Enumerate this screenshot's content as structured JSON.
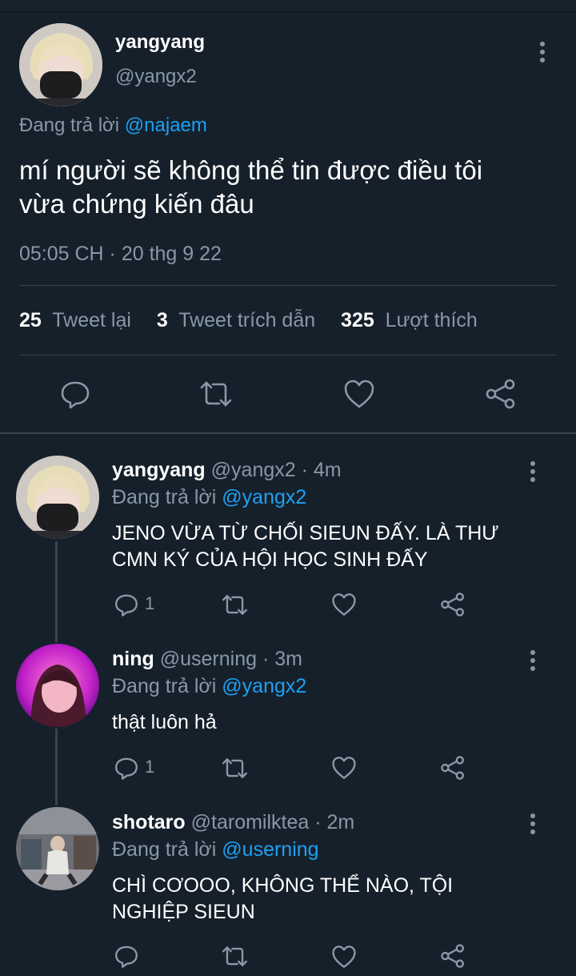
{
  "main_tweet": {
    "display_name": "yangyang",
    "handle": "@yangx2",
    "reply_prefix": "Đang trả lời",
    "reply_to": "@najaem",
    "text_line1": "mí người sẽ không thể tin được điều tôi",
    "text_line2": "vừa chứng kiến đâu",
    "timestamp": "05:05 CH · 20 thg 9 22",
    "retweets": "25",
    "retweets_label": "Tweet lại",
    "quotes": "3",
    "quotes_label": "Tweet trích dẫn",
    "likes": "325",
    "likes_label": "Lượt thích"
  },
  "replies": [
    {
      "display_name": "yangyang",
      "handle": "@yangx2",
      "time": "· 4m",
      "reply_prefix": "Đang trả lời",
      "reply_to": "@yangx2",
      "text_line1": "JENO VỪA TỪ CHỐI SIEUN ĐẤY. LÀ THƯ",
      "text_line2": "CMN KÝ CỦA HỘI HỌC SINH ĐẤY",
      "reply_count": "1"
    },
    {
      "display_name": "ning",
      "handle": "@userning",
      "time": "· 3m",
      "reply_prefix": "Đang trả lời",
      "reply_to": "@yangx2",
      "text_line1": "thật luôn hả",
      "reply_count": "1"
    },
    {
      "display_name": "shotaro",
      "handle": "@taromilktea",
      "time": "· 2m",
      "reply_prefix": "Đang trả lời",
      "reply_to": "@userning",
      "text_line1": "CHÌ CƠOOO, KHÔNG THỂ NÀO, TỘI",
      "text_line2": "NGHIỆP SIEUN"
    }
  ],
  "icons": [
    "more-icon",
    "reply-icon",
    "retweet-icon",
    "like-icon",
    "share-icon"
  ],
  "colors": {
    "background": "#15202b",
    "link": "#1da1f2",
    "secondary_text": "#8899a6",
    "divider": "#38444d"
  }
}
